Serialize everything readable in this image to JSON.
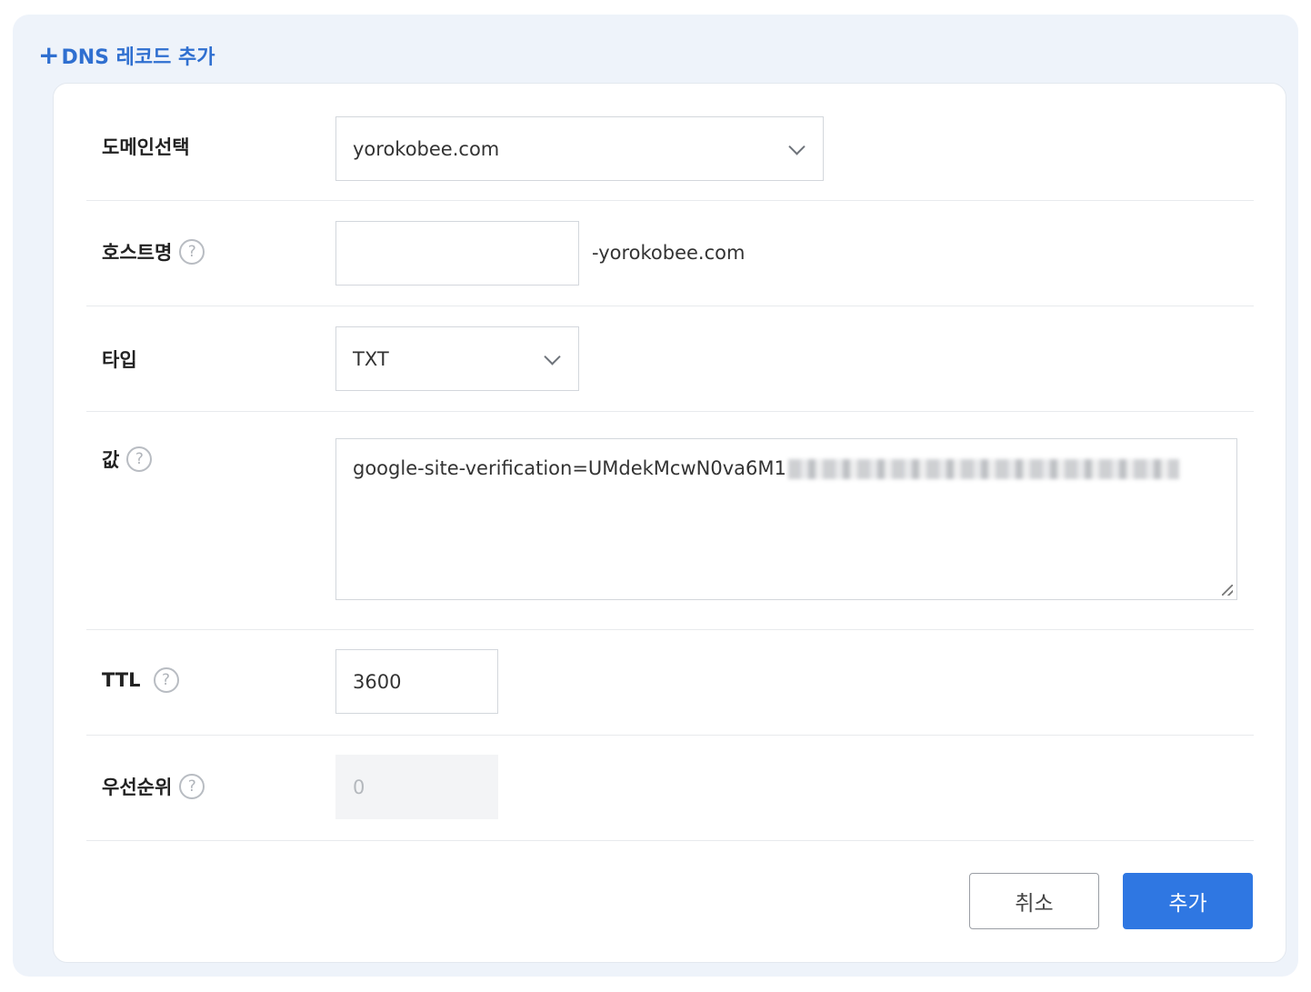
{
  "section": {
    "plus_symbol": "+",
    "title": "DNS 레코드 추가"
  },
  "form": {
    "domain": {
      "label": "도메인선택",
      "selected": "yorokobee.com"
    },
    "hostname": {
      "label": "호스트명",
      "value": "",
      "suffix": "-yorokobee.com"
    },
    "type": {
      "label": "타입",
      "selected": "TXT"
    },
    "value": {
      "label": "값",
      "text": "google-site-verification=UMdekMcwN0va6M1",
      "redacted": true
    },
    "ttl": {
      "label": "TTL",
      "value": "3600"
    },
    "priority": {
      "label": "우선순위",
      "value": "0",
      "disabled": true
    },
    "help_symbol": "?"
  },
  "buttons": {
    "cancel": "취소",
    "add": "추가"
  },
  "colors": {
    "accent": "#2f77e2",
    "title": "#2f6fd0",
    "panel_bg": "#eef3fa"
  }
}
